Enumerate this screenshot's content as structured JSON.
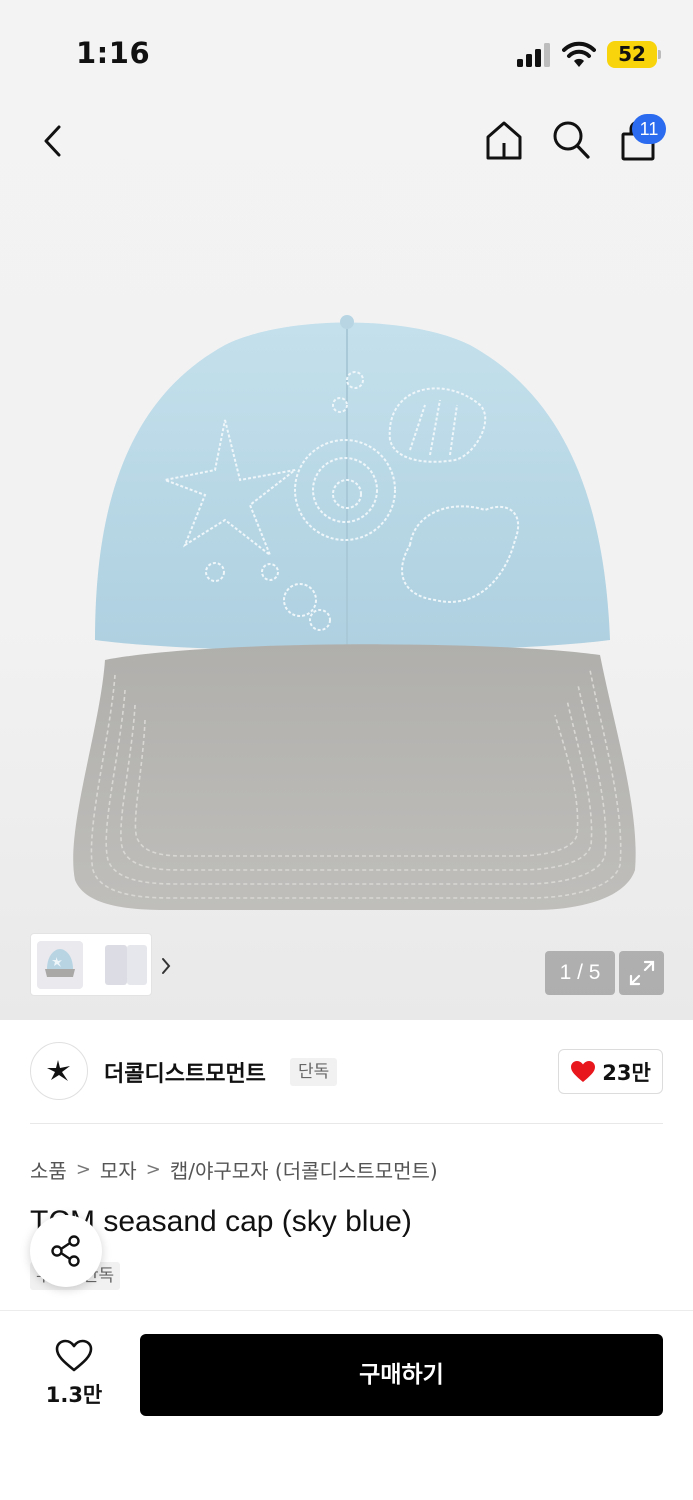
{
  "status_bar": {
    "time": "1:16",
    "battery": "52"
  },
  "header": {
    "cart_count": "11"
  },
  "gallery": {
    "counter": "1 / 5"
  },
  "brand": {
    "name": "더콜디스트모먼트",
    "tag": "단독",
    "likes": "23만"
  },
  "breadcrumb": [
    "소품",
    "모자",
    "캡/야구모자 (더콜디스트모먼트)"
  ],
  "product": {
    "title": "TCM seasand cap (sky blue)",
    "tag": "무신사단독"
  },
  "bottom_bar": {
    "wish_count": "1.3만",
    "buy_label": "구매하기"
  },
  "colors": {
    "cap_crown": "#b9d8e6",
    "cap_brim": "#b9b9b6",
    "like_red": "#e8161d",
    "badge_blue": "#2b6bf0"
  },
  "icons": [
    "back-arrow-icon",
    "home-icon",
    "search-icon",
    "cart-icon",
    "chevron-right-icon",
    "expand-icon",
    "heart-icon",
    "share-icon",
    "star-logo-icon"
  ]
}
